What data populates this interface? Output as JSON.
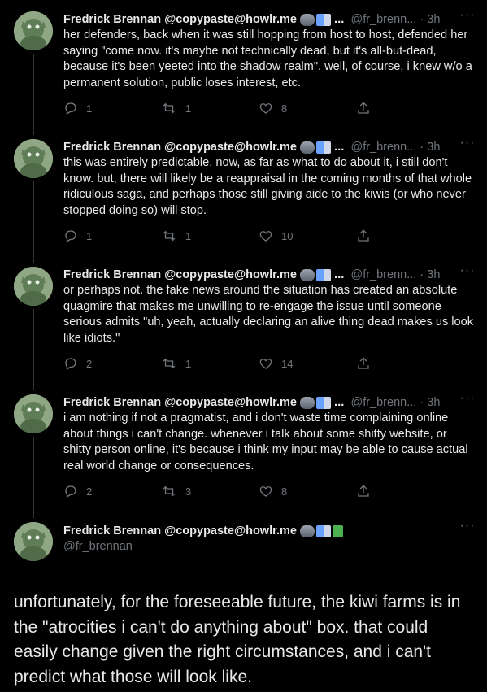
{
  "author": {
    "display_name": "Fredrick Brennan @copypaste@howlr.me",
    "handle_truncated": "@fr_brenn...",
    "handle": "@fr_brennan",
    "badge_overflow": "..."
  },
  "icons": {
    "reply": "reply-icon",
    "retweet": "retweet-icon",
    "like": "heart-icon",
    "share": "share-icon",
    "more": "more-icon"
  },
  "colors": {
    "background": "#000000",
    "text": "#e7e9ea",
    "muted": "#71767b"
  },
  "tweets": [
    {
      "time": "3h",
      "text": "her defenders, back when it was still hopping from host to host, defended her saying \"come now. it's maybe not technically dead, but it's all-but-dead, because it's been yeeted into the shadow realm\". well, of course, i knew w/o a permanent solution, public loses interest, etc.",
      "replies": "1",
      "retweets": "1",
      "likes": "8"
    },
    {
      "time": "3h",
      "text": "this was entirely predictable. now, as far as what to do about it, i still don't know. but, there will likely be a reappraisal in the coming months of that whole ridiculous saga, and perhaps those still giving aide to the kiwis (or who never stopped doing so) will stop.",
      "replies": "1",
      "retweets": "1",
      "likes": "10"
    },
    {
      "time": "3h",
      "text": "or perhaps not. the fake news around the situation has created an absolute quagmire that makes me unwilling to re-engage the issue until someone serious admits \"uh, yeah, actually declaring an alive thing dead makes us look like idiots.\"",
      "replies": "2",
      "retweets": "1",
      "likes": "14"
    },
    {
      "time": "3h",
      "text": "i am nothing if not a pragmatist, and i don't waste time complaining online about things i can't change. whenever i talk about some shitty website, or shitty person online, it's because i think my input may be able to cause actual real world change or consequences.",
      "replies": "2",
      "retweets": "3",
      "likes": "8"
    }
  ],
  "main_tweet": {
    "text": "unfortunately, for the foreseeable future, the kiwi farms is in the \"atrocities i can't do anything about\" box. that could easily change given the right circumstances, and i can't predict what those will look like."
  }
}
